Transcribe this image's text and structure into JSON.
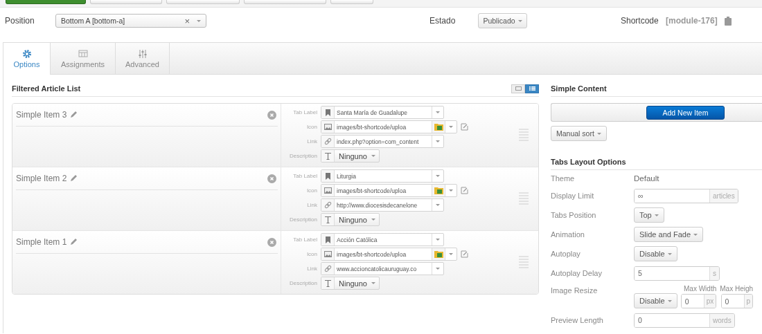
{
  "toolbar_buttons": [
    {
      "kind": "success"
    },
    {
      "kind": "default"
    },
    {
      "kind": "default"
    },
    {
      "kind": "default"
    },
    {
      "kind": "default"
    }
  ],
  "header": {
    "position": {
      "label": "Position",
      "value": "Bottom A [bottom-a]",
      "clear": "×"
    },
    "state": {
      "label": "Estado",
      "value": "Publicado"
    },
    "shortcode": {
      "label": "Shortcode",
      "value": "[module-176]"
    }
  },
  "tabs": [
    {
      "label": "Options",
      "selected": true
    },
    {
      "label": "Assignments",
      "selected": false
    },
    {
      "label": "Advanced",
      "selected": false
    }
  ],
  "filtered_list": {
    "title": "Filtered Article List",
    "layout_toggle": [
      {
        "selected": false
      },
      {
        "selected": true
      }
    ],
    "items": [
      {
        "title": "Simple Item 3",
        "fields": {
          "tab_label": {
            "label": "Tab Label",
            "value": "Santa María de Guadalupe"
          },
          "icon": {
            "label": "Icon",
            "value": "images/bt-shortcode/uploa"
          },
          "link": {
            "label": "Link",
            "value": "index.php?option=com_content"
          },
          "description": {
            "label": "Description",
            "value": "Ninguno"
          }
        }
      },
      {
        "title": "Simple Item 2",
        "fields": {
          "tab_label": {
            "label": "Tab Label",
            "value": "Liturgia"
          },
          "icon": {
            "label": "Icon",
            "value": "images/bt-shortcode/uploa"
          },
          "link": {
            "label": "Link",
            "value": "http://www.diocesisdecanelone"
          },
          "description": {
            "label": "Description",
            "value": "Ninguno"
          }
        }
      },
      {
        "title": "Simple Item 1",
        "fields": {
          "tab_label": {
            "label": "Tab Label",
            "value": "Acción Católica"
          },
          "icon": {
            "label": "Icon",
            "value": "images/bt-shortcode/uploa"
          },
          "link": {
            "label": "Link",
            "value": "www.accioncatolicauruguay.co"
          },
          "description": {
            "label": "Description",
            "value": "Ninguno"
          }
        }
      }
    ]
  },
  "simple_content": {
    "title": "Simple Content",
    "add_button": "Add New Item",
    "sort": "Manual sort"
  },
  "tabs_layout": {
    "title": "Tabs Layout Options",
    "rows": [
      {
        "kind": "text",
        "label": "Theme",
        "value": "Default"
      },
      {
        "kind": "input",
        "label": "Display Limit",
        "value": "∞",
        "addon": "articles"
      },
      {
        "kind": "select",
        "label": "Tabs Position",
        "value": "Top"
      },
      {
        "kind": "select",
        "label": "Animation",
        "value": "Slide and Fade"
      },
      {
        "kind": "select",
        "label": "Autoplay",
        "value": "Disable"
      },
      {
        "kind": "input",
        "label": "Autoplay Delay",
        "value": "5",
        "addon": "s"
      },
      {
        "kind": "resize",
        "label": "Image Resize",
        "value": "Disable",
        "sizes": [
          {
            "label": "Max Width",
            "value": "0",
            "addon": "px"
          },
          {
            "label": "Max Heigh",
            "value": "0",
            "addon": "p"
          }
        ]
      },
      {
        "kind": "input",
        "label": "Preview Length",
        "value": "0",
        "addon": "words"
      }
    ]
  }
}
